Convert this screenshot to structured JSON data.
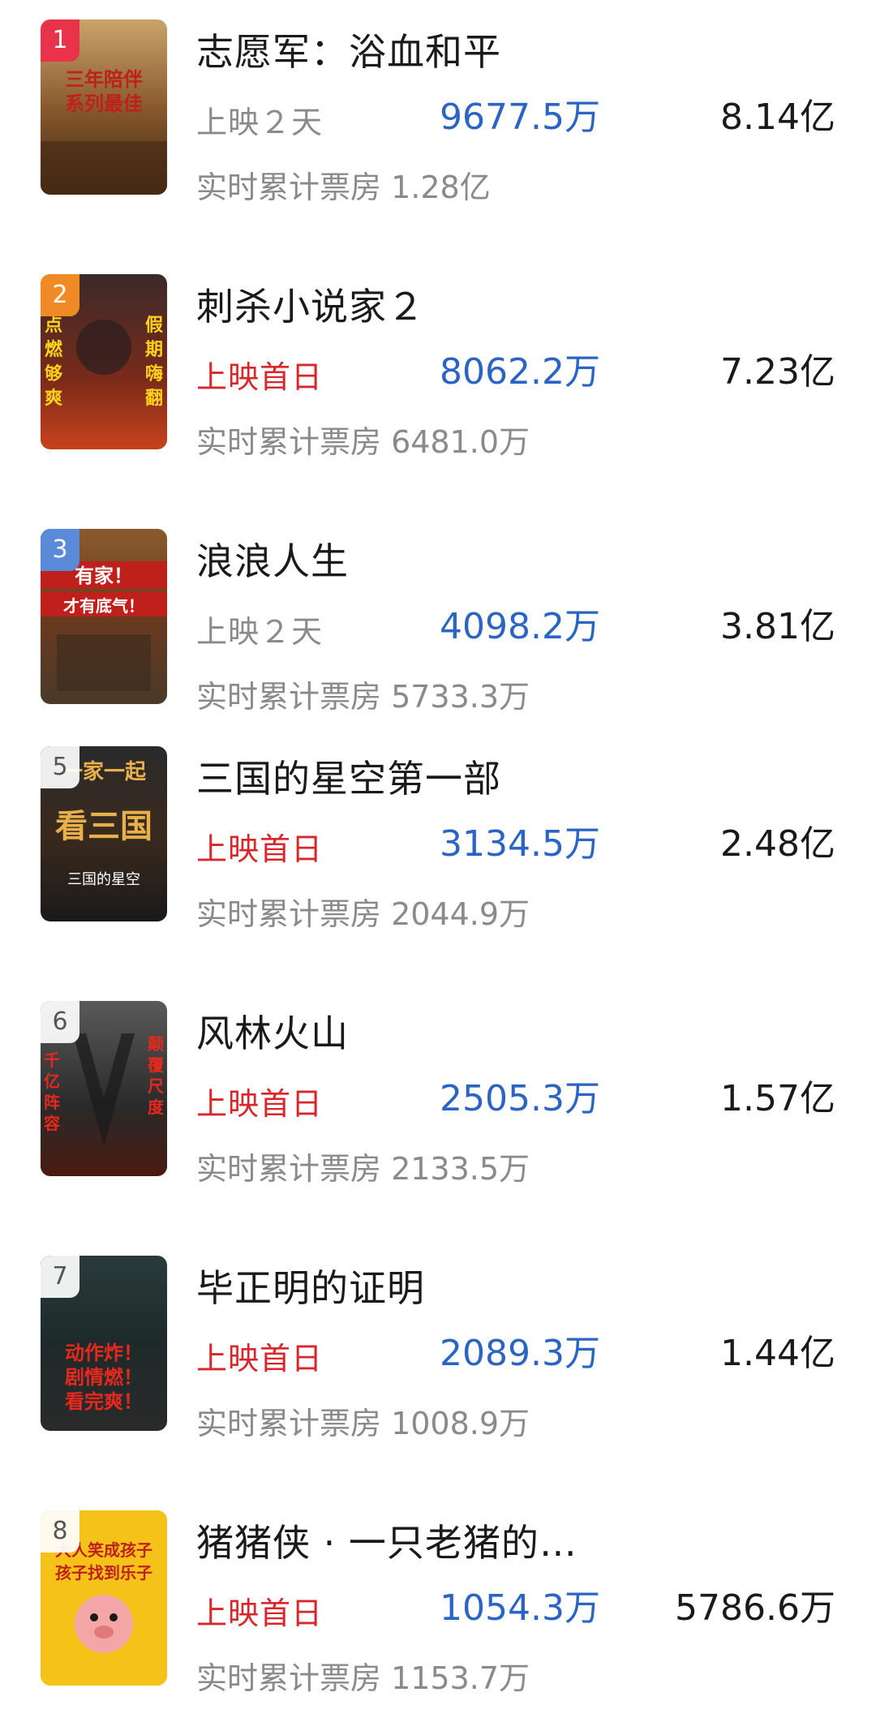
{
  "colors": {
    "daily_blue": "#2a64c5",
    "premiere_red": "#d9262b",
    "muted_gray": "#8a8a8a",
    "rank_1": "#e8334a",
    "rank_2": "#f08a24",
    "rank_3": "#5a8ad8"
  },
  "movies": [
    {
      "rank": "1",
      "title": "志愿军：浴血和平",
      "days": "上映２天",
      "daily": "9677.5万",
      "total": "8.14亿",
      "cumulative": "实时累计票房 1.28亿",
      "poster_text": "三年陪伴系列最佳"
    },
    {
      "rank": "2",
      "title": "刺杀小说家２",
      "days": "上映首日",
      "daily": "8062.2万",
      "total": "7.23亿",
      "cumulative": "实时累计票房 6481.0万",
      "poster_text_left": "点燃够爽",
      "poster_text_right": "假期嗨翻"
    },
    {
      "rank": "3",
      "title": "浪浪人生",
      "days": "上映２天",
      "daily": "4098.2万",
      "total": "3.81亿",
      "cumulative": "实时累计票房 5733.3万",
      "poster_text_top": "有家！",
      "poster_text_mid": "才有底气！"
    },
    {
      "rank": "5",
      "title": "三国的星空第一部",
      "days": "上映首日",
      "daily": "3134.5万",
      "total": "2.48亿",
      "cumulative": "实时累计票房 2044.9万",
      "poster_text_top": "一家一起",
      "poster_text_mid": "看三国"
    },
    {
      "rank": "6",
      "title": "风林火山",
      "days": "上映首日",
      "daily": "2505.3万",
      "total": "1.57亿",
      "cumulative": "实时累计票房 2133.5万",
      "poster_text_left": "千亿阵容",
      "poster_text_right": "颠覆尺度"
    },
    {
      "rank": "7",
      "title": "毕正明的证明",
      "days": "上映首日",
      "daily": "2089.3万",
      "total": "1.44亿",
      "cumulative": "实时累计票房 1008.9万",
      "poster_text": "动作炸！剧情燃！看完爽！"
    },
    {
      "rank": "8",
      "title": "猪猪侠 · 一只老猪的…",
      "days": "上映首日",
      "daily": "1054.3万",
      "total": "5786.6万",
      "cumulative": "实时累计票房 1153.7万",
      "poster_text_top": "大人笑成孩子",
      "poster_text_mid": "孩子找到乐子"
    }
  ]
}
